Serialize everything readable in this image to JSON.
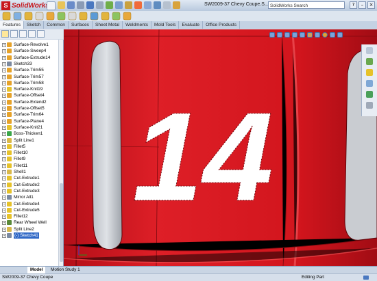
{
  "app": {
    "name": "SolidWorks"
  },
  "window": {
    "title": "SW2009-37 Chevy Coupe.S...",
    "search_placeholder": "SolidWorks Search"
  },
  "command_tabs": [
    "Features",
    "Sketch",
    "Common",
    "Surfaces",
    "Sheet Metal",
    "Weldments",
    "Mold Tools",
    "Evaluate",
    "Office Products"
  ],
  "active_command_tab": "Features",
  "feature_tree": {
    "items": [
      {
        "label": "Surface-Revolve1",
        "icon": "surface-icon",
        "color": "#e6a22a"
      },
      {
        "label": "Surface-Sweep4",
        "icon": "surface-icon",
        "color": "#e6a22a"
      },
      {
        "label": "Surface-Extrude14",
        "icon": "surface-icon",
        "color": "#e6a22a"
      },
      {
        "label": "Sketch33",
        "icon": "sketch-icon",
        "color": "#7c8aa0"
      },
      {
        "label": "Surface-Trim55",
        "icon": "surface-trim-icon",
        "color": "#e6a22a"
      },
      {
        "label": "Surface-Trim57",
        "icon": "surface-trim-icon",
        "color": "#e6a22a"
      },
      {
        "label": "Surface-Trim58",
        "icon": "surface-trim-icon",
        "color": "#e6a22a"
      },
      {
        "label": "Surface-Knit19",
        "icon": "surface-knit-icon",
        "color": "#e6c22a"
      },
      {
        "label": "Surface-Offset4",
        "icon": "surface-offset-icon",
        "color": "#e6a22a"
      },
      {
        "label": "Surface-Extend2",
        "icon": "surface-extend-icon",
        "color": "#e6a22a"
      },
      {
        "label": "Surface-Offset5",
        "icon": "surface-offset-icon",
        "color": "#e6a22a"
      },
      {
        "label": "Surface-Trim64",
        "icon": "surface-trim-icon",
        "color": "#e6a22a"
      },
      {
        "label": "Surface-Plane4",
        "icon": "surface-plane-icon",
        "color": "#e6a22a"
      },
      {
        "label": "Surface-Knit21",
        "icon": "surface-knit-icon",
        "color": "#e6c22a"
      },
      {
        "label": "Boss-Thicken1",
        "icon": "thicken-icon",
        "color": "#3aa64a"
      },
      {
        "label": "Split Line1",
        "icon": "split-line-icon",
        "color": "#d9b84a"
      },
      {
        "label": "Fillet5",
        "icon": "fillet-icon",
        "color": "#e6c22a"
      },
      {
        "label": "Fillet10",
        "icon": "fillet-icon",
        "color": "#e6c22a"
      },
      {
        "label": "Fillet9",
        "icon": "fillet-icon",
        "color": "#e6c22a"
      },
      {
        "label": "Fillet11",
        "icon": "fillet-icon",
        "color": "#e6c22a"
      },
      {
        "label": "Shell1",
        "icon": "shell-icon",
        "color": "#d9b84a"
      },
      {
        "label": "Cut-Extrude1",
        "icon": "cut-extrude-icon",
        "color": "#e6c22a"
      },
      {
        "label": "Cut-Extrude2",
        "icon": "cut-extrude-icon",
        "color": "#e6c22a"
      },
      {
        "label": "Cut-Extrude3",
        "icon": "cut-extrude-icon",
        "color": "#e6c22a"
      },
      {
        "label": "Mirror All1",
        "icon": "mirror-icon",
        "color": "#7c8aa0"
      },
      {
        "label": "Cut-Extrude4",
        "icon": "cut-extrude-icon",
        "color": "#e6c22a"
      },
      {
        "label": "Cut-Extrude5",
        "icon": "cut-extrude-icon",
        "color": "#e6c22a"
      },
      {
        "label": "Fillet12",
        "icon": "fillet-icon",
        "color": "#e6c22a"
      },
      {
        "label": "Rear Wheel Well",
        "icon": "wheel-well-icon",
        "color": "#5a8a3a"
      },
      {
        "label": "Split Line2",
        "icon": "split-line-icon",
        "color": "#d9b84a"
      },
      {
        "label": "(-) Sketch41",
        "icon": "sketch-icon",
        "color": "#7c8aa0"
      }
    ],
    "selected_index": 30
  },
  "model_view": {
    "number_text": "14",
    "body_color": "#d01520"
  },
  "bottom_tabs": [
    "Model",
    "Motion Study 1"
  ],
  "active_bottom_tab": "Model",
  "status": {
    "left": "SW2009-37 Chevy Coupe",
    "right": "Editing Part"
  }
}
